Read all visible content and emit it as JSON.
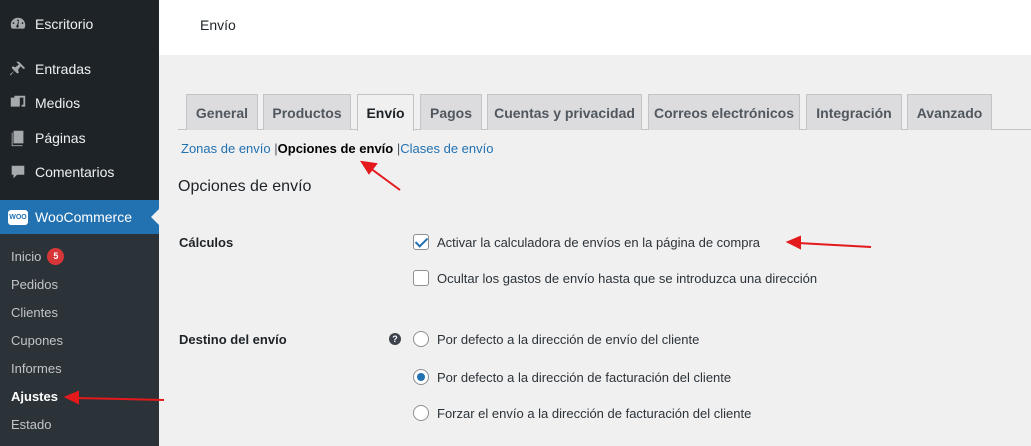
{
  "sidebar": {
    "menu": [
      {
        "label": "Escritorio",
        "icon": "dashboard-icon"
      },
      {
        "label": "Entradas",
        "icon": "pin-icon"
      },
      {
        "label": "Medios",
        "icon": "media-icon"
      },
      {
        "label": "Páginas",
        "icon": "pages-icon"
      },
      {
        "label": "Comentarios",
        "icon": "comments-icon"
      },
      {
        "label": "WooCommerce",
        "icon": "woocommerce-icon"
      }
    ],
    "woo_logo_text": "WOO",
    "submenu": [
      {
        "label": "Inicio",
        "badge": "5"
      },
      {
        "label": "Pedidos"
      },
      {
        "label": "Clientes"
      },
      {
        "label": "Cupones"
      },
      {
        "label": "Informes"
      },
      {
        "label": "Ajustes"
      },
      {
        "label": "Estado"
      }
    ]
  },
  "header": {
    "title": "Envío"
  },
  "tabs": [
    {
      "label": "General"
    },
    {
      "label": "Productos"
    },
    {
      "label": "Envío"
    },
    {
      "label": "Pagos"
    },
    {
      "label": "Cuentas y privacidad"
    },
    {
      "label": "Correos electrónicos"
    },
    {
      "label": "Integración"
    },
    {
      "label": "Avanzado"
    }
  ],
  "sublinks": {
    "zonas": "Zonas de envío",
    "opciones": "Opciones de envío",
    "clases": "Clases de envío",
    "sep": "|"
  },
  "section_title": "Opciones de envío",
  "calculos": {
    "label": "Cálculos",
    "options": [
      {
        "label": "Activar la calculadora de envíos en la página de compra",
        "checked": true
      },
      {
        "label": "Ocultar los gastos de envío hasta que se introduzca una dirección",
        "checked": false
      }
    ]
  },
  "destino": {
    "label": "Destino del envío",
    "help_icon": "?",
    "options": [
      {
        "label": "Por defecto a la dirección de envío del cliente",
        "checked": false
      },
      {
        "label": "Por defecto a la dirección de facturación del cliente",
        "checked": true
      },
      {
        "label": "Forzar el envío a la dirección de facturación del cliente",
        "checked": false
      }
    ]
  },
  "colors": {
    "annotation_arrow": "#e3191c",
    "accent": "#2271b1",
    "sidebar_bg": "#1d2327"
  }
}
